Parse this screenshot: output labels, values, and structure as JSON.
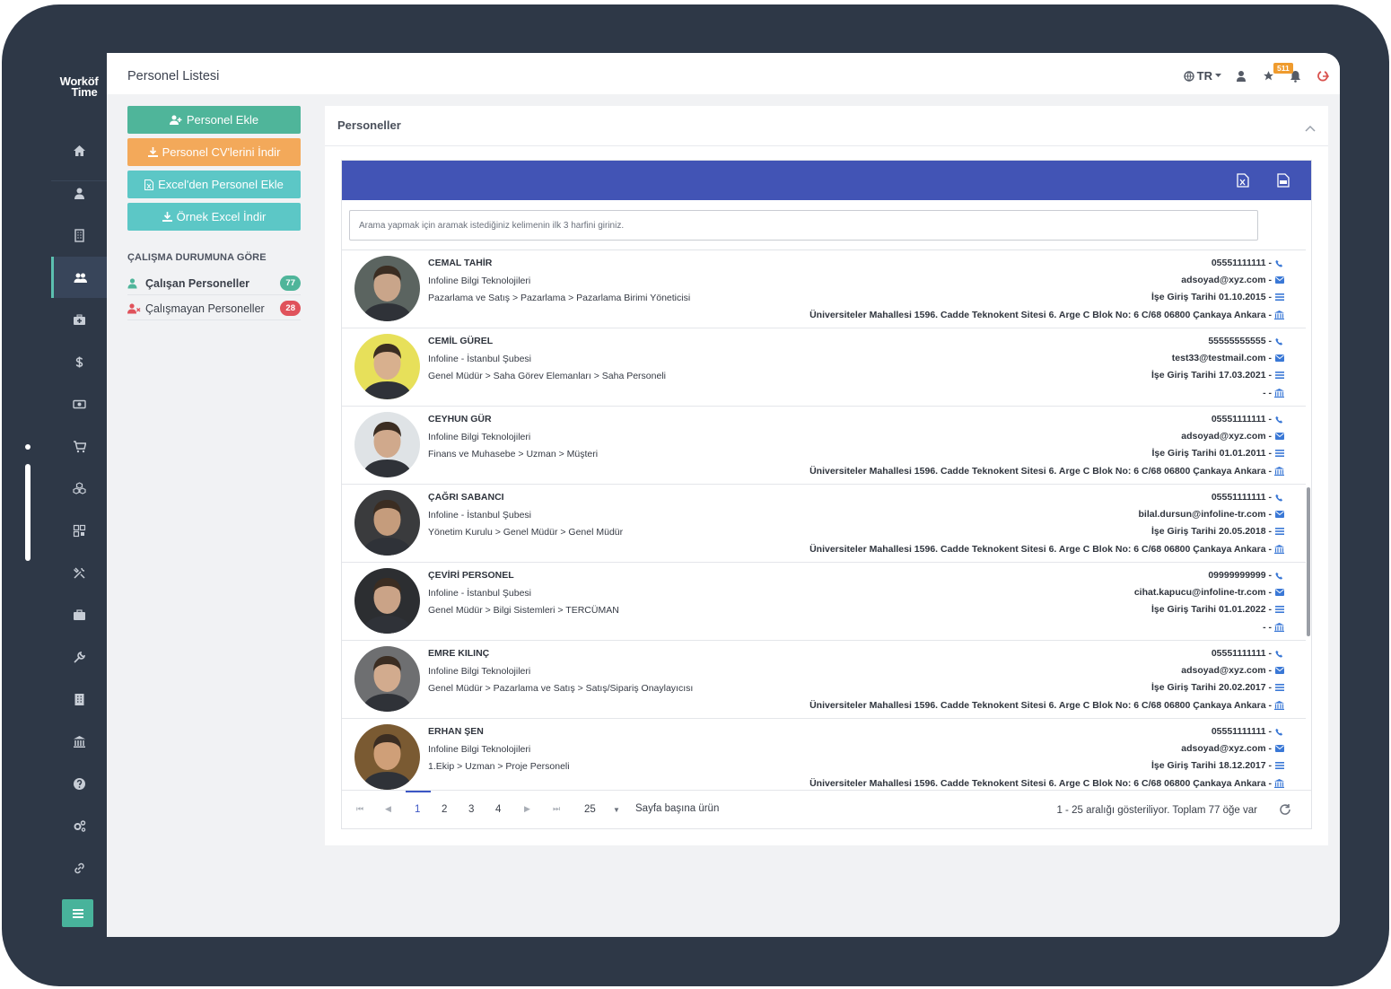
{
  "app": {
    "logo_line1": "Worköf",
    "logo_line2": "Time"
  },
  "colors": {
    "nav_bg": "#2e3847",
    "accent_green": "#4fb59a",
    "accent_orange": "#f3a95a",
    "accent_teal": "#5cc7c6",
    "grid_header": "#4254b5",
    "badge_orange": "#ef9b2e",
    "badge_green": "#4fb59a",
    "badge_red": "#e0525b"
  },
  "nav": {
    "items": [
      "home-icon",
      "user-icon",
      "building-icon",
      "users-icon",
      "medkit-icon",
      "dollar-icon",
      "money-icon",
      "cart-icon",
      "cubes-icon",
      "barcode-icon",
      "tools-icon",
      "briefcase-icon",
      "wrench-icon",
      "building-alt-icon",
      "bank-icon",
      "question-icon",
      "settings-icon",
      "link-icon"
    ],
    "active_index": 3
  },
  "topbar": {
    "title": "Personel Listesi",
    "language": "TR",
    "notification_count": "511"
  },
  "actions": {
    "add_personnel": "Personel Ekle",
    "download_cv": "Personel CV'lerini İndir",
    "import_excel": "Excel'den Personel Ekle",
    "sample_excel": "Örnek Excel İndir"
  },
  "status_filter": {
    "heading": "ÇALIŞMA DURUMUNA GÖRE",
    "working_label": "Çalışan Personeller",
    "working_count": "77",
    "not_working_label": "Çalışmayan Personeller",
    "not_working_count": "28"
  },
  "panel": {
    "title": "Personeller",
    "search_placeholder": "Arama yapmak için aramak istediğiniz kelimenin ilk 3 harfini giriniz."
  },
  "personnel": [
    {
      "name": "CEMAL TAHİR",
      "company": "Infoline Bilgi Teknolojileri",
      "path": "Pazarlama ve Satış > Pazarlama > Pazarlama Birimi Yöneticisi",
      "phone": "05551111111 -",
      "email": "adsoyad@xyz.com -",
      "start": "İşe Giriş Tarihi 01.10.2015 -",
      "address": "Üniversiteler Mahallesi 1596. Cadde Teknokent Sitesi 6. Arge C Blok No: 6 C/68 06800 Çankaya Ankara -",
      "avatar_bg": "#5b6460",
      "avatar_face": "#c9a58a"
    },
    {
      "name": "CEMİL GÜREL",
      "company": "Infoline - İstanbul Şubesi",
      "path": "Genel Müdür > Saha Görev Elemanları > Saha Personeli",
      "phone": "55555555555 -",
      "email": "test33@testmail.com -",
      "start": "İşe Giriş Tarihi 17.03.2021 -",
      "address": "- -",
      "avatar_bg": "#e7e05a",
      "avatar_face": "#d8b08e"
    },
    {
      "name": "CEYHUN GÜR",
      "company": "Infoline Bilgi Teknolojileri",
      "path": "Finans ve Muhasebe > Uzman > Müşteri",
      "phone": "05551111111 -",
      "email": "adsoyad@xyz.com -",
      "start": "İşe Giriş Tarihi 01.01.2011 -",
      "address": "Üniversiteler Mahallesi 1596. Cadde Teknokent Sitesi 6. Arge C Blok No: 6 C/68 06800 Çankaya Ankara -",
      "avatar_bg": "#dfe3e6",
      "avatar_face": "#d0a98c"
    },
    {
      "name": "ÇAĞRI SABANCI",
      "company": "Infoline - İstanbul Şubesi",
      "path": "Yönetim Kurulu > Genel Müdür > Genel Müdür",
      "phone": "05551111111 -",
      "email": "bilal.dursun@infoline-tr.com -",
      "start": "İşe Giriş Tarihi 20.05.2018 -",
      "address": "Üniversiteler Mahallesi 1596. Cadde Teknokent Sitesi 6. Arge C Blok No: 6 C/68 06800 Çankaya Ankara -",
      "avatar_bg": "#3a3b3d",
      "avatar_face": "#c59c7c"
    },
    {
      "name": "ÇEVİRİ PERSONEL",
      "company": "Infoline - İstanbul Şubesi",
      "path": "Genel Müdür > Bilgi Sistemleri > TERCÜMAN",
      "phone": "09999999999 -",
      "email": "cihat.kapucu@infoline-tr.com -",
      "start": "İşe Giriş Tarihi 01.01.2022 -",
      "address": "- -",
      "avatar_bg": "#2c2e31",
      "avatar_face": "#caa387"
    },
    {
      "name": "EMRE KILINÇ",
      "company": "Infoline Bilgi Teknolojileri",
      "path": "Genel Müdür > Pazarlama ve Satış > Satış/Sipariş Onaylayıcısı",
      "phone": "05551111111 -",
      "email": "adsoyad@xyz.com -",
      "start": "İşe Giriş Tarihi 20.02.2017 -",
      "address": "Üniversiteler Mahallesi 1596. Cadde Teknokent Sitesi 6. Arge C Blok No: 6 C/68 06800 Çankaya Ankara -",
      "avatar_bg": "#6e6f71",
      "avatar_face": "#d2ab8e"
    },
    {
      "name": "ERHAN ŞEN",
      "company": "Infoline Bilgi Teknolojileri",
      "path": "1.Ekip > Uzman > Proje Personeli",
      "phone": "05551111111 -",
      "email": "adsoyad@xyz.com -",
      "start": "İşe Giriş Tarihi 18.12.2017 -",
      "address": "Üniversiteler Mahallesi 1596. Cadde Teknokent Sitesi 6. Arge C Blok No: 6 C/68 06800 Çankaya Ankara -",
      "avatar_bg": "#7a5a32",
      "avatar_face": "#cf9f78"
    }
  ],
  "pager": {
    "pages": [
      "1",
      "2",
      "3",
      "4"
    ],
    "current": "1",
    "page_size": "25",
    "page_size_label": "Sayfa başına ürün",
    "info": "1 - 25 aralığı gösteriliyor. Toplam 77 öğe var"
  }
}
